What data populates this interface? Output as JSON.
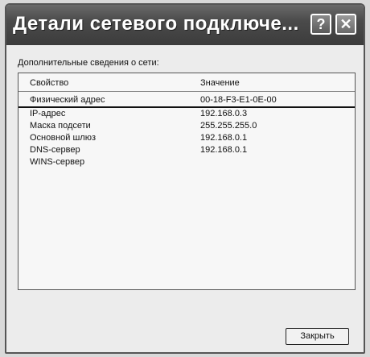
{
  "window": {
    "title": "Детали сетевого подключе...",
    "help_label": "?",
    "close_label": "✕"
  },
  "subtitle": "Дополнительные сведения о сети:",
  "table": {
    "headers": [
      "Свойство",
      "Значение"
    ],
    "rows": [
      {
        "property": "Физический адрес",
        "value": "00-18-F3-E1-0E-00"
      },
      {
        "property": "IP-адрес",
        "value": "192.168.0.3"
      },
      {
        "property": "Маска подсети",
        "value": "255.255.255.0"
      },
      {
        "property": "Основной шлюз",
        "value": "192.168.0.1"
      },
      {
        "property": "DNS-сервер",
        "value": "192.168.0.1"
      },
      {
        "property": "WINS-сервер",
        "value": ""
      }
    ]
  },
  "button": {
    "close_label": "Закрыть"
  }
}
